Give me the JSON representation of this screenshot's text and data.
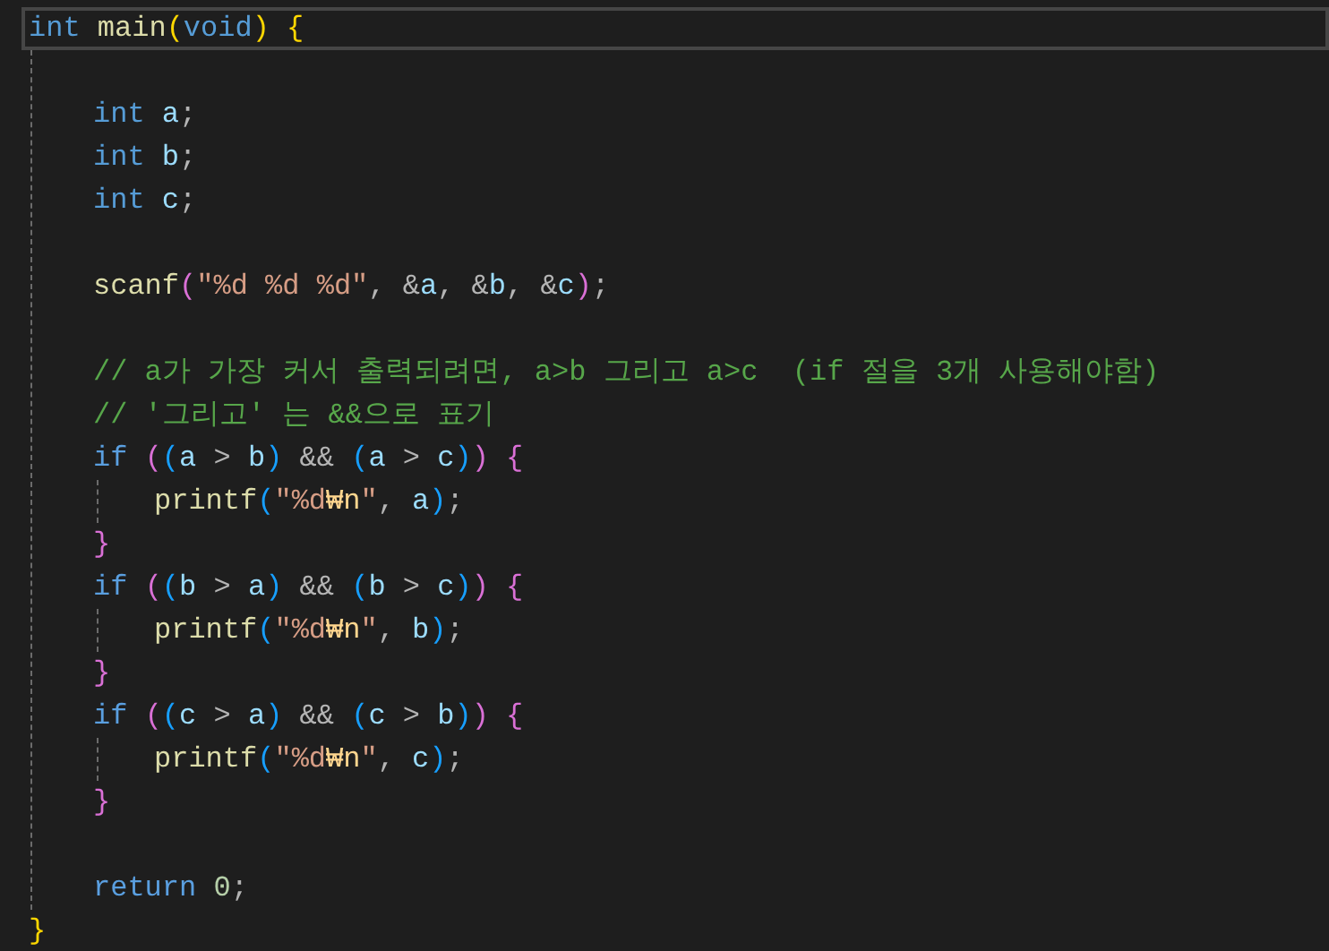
{
  "editor": {
    "lines": [
      {
        "kind": "code",
        "current": true,
        "tokens": [
          {
            "kind": "keyword",
            "text": "int "
          },
          {
            "kind": "function",
            "text": "main"
          },
          {
            "kind": "bracket1",
            "text": "("
          },
          {
            "kind": "keyword",
            "text": "void"
          },
          {
            "kind": "bracket1",
            "text": ")"
          },
          {
            "kind": "bracket1",
            "text": " {"
          }
        ],
        "children": [
          {
            "kind": "blank"
          },
          {
            "kind": "code",
            "tokens": [
              {
                "kind": "keyword",
                "text": "int "
              },
              {
                "kind": "variable",
                "text": "a"
              },
              {
                "kind": "plain",
                "text": ";"
              }
            ]
          },
          {
            "kind": "code",
            "tokens": [
              {
                "kind": "keyword",
                "text": "int "
              },
              {
                "kind": "variable",
                "text": "b"
              },
              {
                "kind": "plain",
                "text": ";"
              }
            ]
          },
          {
            "kind": "code",
            "tokens": [
              {
                "kind": "keyword",
                "text": "int "
              },
              {
                "kind": "variable",
                "text": "c"
              },
              {
                "kind": "plain",
                "text": ";"
              }
            ]
          },
          {
            "kind": "blank"
          },
          {
            "kind": "code",
            "tokens": [
              {
                "kind": "function",
                "text": "scanf"
              },
              {
                "kind": "bracket2",
                "text": "("
              },
              {
                "kind": "string",
                "text": "\"%d %d %d\""
              },
              {
                "kind": "plain",
                "text": ", "
              },
              {
                "kind": "operator",
                "text": "&"
              },
              {
                "kind": "variable",
                "text": "a"
              },
              {
                "kind": "plain",
                "text": ", "
              },
              {
                "kind": "operator",
                "text": "&"
              },
              {
                "kind": "variable",
                "text": "b"
              },
              {
                "kind": "plain",
                "text": ", "
              },
              {
                "kind": "operator",
                "text": "&"
              },
              {
                "kind": "variable",
                "text": "c"
              },
              {
                "kind": "bracket2",
                "text": ")"
              },
              {
                "kind": "plain",
                "text": ";"
              }
            ]
          },
          {
            "kind": "blank"
          },
          {
            "kind": "code",
            "tokens": [
              {
                "kind": "comment",
                "text": "// a가 가장 커서 출력되려면, a>b 그리고 a>c  (if 절을 3개 사용해야함)"
              }
            ]
          },
          {
            "kind": "code",
            "tokens": [
              {
                "kind": "comment",
                "text": "// '그리고' 는 &&으로 표기"
              }
            ]
          },
          {
            "kind": "code",
            "tokens": [
              {
                "kind": "control",
                "text": "if "
              },
              {
                "kind": "bracket2",
                "text": "("
              },
              {
                "kind": "bracket3",
                "text": "("
              },
              {
                "kind": "variable",
                "text": "a"
              },
              {
                "kind": "operator",
                "text": " > "
              },
              {
                "kind": "variable",
                "text": "b"
              },
              {
                "kind": "bracket3",
                "text": ")"
              },
              {
                "kind": "operator",
                "text": " && "
              },
              {
                "kind": "bracket3",
                "text": "("
              },
              {
                "kind": "variable",
                "text": "a"
              },
              {
                "kind": "operator",
                "text": " > "
              },
              {
                "kind": "variable",
                "text": "c"
              },
              {
                "kind": "bracket3",
                "text": ")"
              },
              {
                "kind": "bracket2",
                "text": ")"
              },
              {
                "kind": "bracket2",
                "text": " {"
              }
            ],
            "children": [
              {
                "kind": "code",
                "tokens": [
                  {
                    "kind": "function",
                    "text": "printf"
                  },
                  {
                    "kind": "bracket3",
                    "text": "("
                  },
                  {
                    "kind": "string",
                    "text": "\"%d"
                  },
                  {
                    "kind": "escape",
                    "text": "₩n"
                  },
                  {
                    "kind": "string",
                    "text": "\""
                  },
                  {
                    "kind": "plain",
                    "text": ", "
                  },
                  {
                    "kind": "variable",
                    "text": "a"
                  },
                  {
                    "kind": "bracket3",
                    "text": ")"
                  },
                  {
                    "kind": "plain",
                    "text": ";"
                  }
                ]
              }
            ]
          },
          {
            "kind": "code",
            "tokens": [
              {
                "kind": "bracket2",
                "text": "}"
              }
            ]
          },
          {
            "kind": "code",
            "tokens": [
              {
                "kind": "control",
                "text": "if "
              },
              {
                "kind": "bracket2",
                "text": "("
              },
              {
                "kind": "bracket3",
                "text": "("
              },
              {
                "kind": "variable",
                "text": "b"
              },
              {
                "kind": "operator",
                "text": " > "
              },
              {
                "kind": "variable",
                "text": "a"
              },
              {
                "kind": "bracket3",
                "text": ")"
              },
              {
                "kind": "operator",
                "text": " && "
              },
              {
                "kind": "bracket3",
                "text": "("
              },
              {
                "kind": "variable",
                "text": "b"
              },
              {
                "kind": "operator",
                "text": " > "
              },
              {
                "kind": "variable",
                "text": "c"
              },
              {
                "kind": "bracket3",
                "text": ")"
              },
              {
                "kind": "bracket2",
                "text": ")"
              },
              {
                "kind": "bracket2",
                "text": " {"
              }
            ],
            "children": [
              {
                "kind": "code",
                "tokens": [
                  {
                    "kind": "function",
                    "text": "printf"
                  },
                  {
                    "kind": "bracket3",
                    "text": "("
                  },
                  {
                    "kind": "string",
                    "text": "\"%d"
                  },
                  {
                    "kind": "escape",
                    "text": "₩n"
                  },
                  {
                    "kind": "string",
                    "text": "\""
                  },
                  {
                    "kind": "plain",
                    "text": ", "
                  },
                  {
                    "kind": "variable",
                    "text": "b"
                  },
                  {
                    "kind": "bracket3",
                    "text": ")"
                  },
                  {
                    "kind": "plain",
                    "text": ";"
                  }
                ]
              }
            ]
          },
          {
            "kind": "code",
            "tokens": [
              {
                "kind": "bracket2",
                "text": "}"
              }
            ]
          },
          {
            "kind": "code",
            "tokens": [
              {
                "kind": "control",
                "text": "if "
              },
              {
                "kind": "bracket2",
                "text": "("
              },
              {
                "kind": "bracket3",
                "text": "("
              },
              {
                "kind": "variable",
                "text": "c"
              },
              {
                "kind": "operator",
                "text": " > "
              },
              {
                "kind": "variable",
                "text": "a"
              },
              {
                "kind": "bracket3",
                "text": ")"
              },
              {
                "kind": "operator",
                "text": " && "
              },
              {
                "kind": "bracket3",
                "text": "("
              },
              {
                "kind": "variable",
                "text": "c"
              },
              {
                "kind": "operator",
                "text": " > "
              },
              {
                "kind": "variable",
                "text": "b"
              },
              {
                "kind": "bracket3",
                "text": ")"
              },
              {
                "kind": "bracket2",
                "text": ")"
              },
              {
                "kind": "bracket2",
                "text": " {"
              }
            ],
            "children": [
              {
                "kind": "code",
                "tokens": [
                  {
                    "kind": "function",
                    "text": "printf"
                  },
                  {
                    "kind": "bracket3",
                    "text": "("
                  },
                  {
                    "kind": "string",
                    "text": "\"%d"
                  },
                  {
                    "kind": "escape",
                    "text": "₩n"
                  },
                  {
                    "kind": "string",
                    "text": "\""
                  },
                  {
                    "kind": "plain",
                    "text": ", "
                  },
                  {
                    "kind": "variable",
                    "text": "c"
                  },
                  {
                    "kind": "bracket3",
                    "text": ")"
                  },
                  {
                    "kind": "plain",
                    "text": ";"
                  }
                ]
              }
            ]
          },
          {
            "kind": "code",
            "tokens": [
              {
                "kind": "bracket2",
                "text": "}"
              }
            ]
          },
          {
            "kind": "blank"
          },
          {
            "kind": "code",
            "tokens": [
              {
                "kind": "control",
                "text": "return "
              },
              {
                "kind": "number",
                "text": "0"
              },
              {
                "kind": "plain",
                "text": ";"
              }
            ]
          }
        ]
      },
      {
        "kind": "code",
        "tokens": [
          {
            "kind": "bracket1",
            "text": "}"
          }
        ]
      }
    ]
  }
}
